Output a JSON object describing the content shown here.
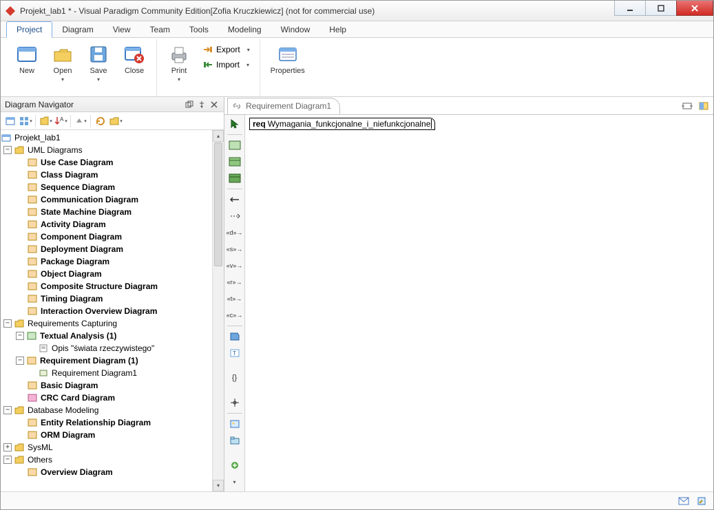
{
  "window": {
    "title": "Projekt_lab1 * - Visual Paradigm Community Edition[Zofia Kruczkiewicz] (not for commercial use)"
  },
  "menubar": {
    "items": [
      {
        "label": "Project",
        "active": true
      },
      {
        "label": "Diagram"
      },
      {
        "label": "View"
      },
      {
        "label": "Team"
      },
      {
        "label": "Tools"
      },
      {
        "label": "Modeling"
      },
      {
        "label": "Window"
      },
      {
        "label": "Help"
      }
    ]
  },
  "ribbon": {
    "new": "New",
    "open": "Open",
    "save": "Save",
    "close": "Close",
    "print": "Print",
    "export": "Export",
    "import": "Import",
    "properties": "Properties"
  },
  "navigator": {
    "title": "Diagram Navigator",
    "root": "Projekt_lab1",
    "groups": {
      "uml": {
        "label": "UML Diagrams",
        "items": [
          "Use Case Diagram",
          "Class Diagram",
          "Sequence Diagram",
          "Communication Diagram",
          "State Machine Diagram",
          "Activity Diagram",
          "Component Diagram",
          "Deployment Diagram",
          "Package Diagram",
          "Object Diagram",
          "Composite Structure Diagram",
          "Timing Diagram",
          "Interaction Overview Diagram"
        ]
      },
      "requirements": {
        "label": "Requirements Capturing",
        "textual_analysis": {
          "label": "Textual Analysis (1)",
          "child": "Opis \"świata rzeczywistego\""
        },
        "requirement_diagram": {
          "label": "Requirement Diagram (1)",
          "child": "Requirement Diagram1"
        },
        "basic_diagram": "Basic Diagram",
        "crc": "CRC Card Diagram"
      },
      "database": {
        "label": "Database Modeling",
        "items": [
          "Entity Relationship Diagram",
          "ORM Diagram"
        ]
      },
      "sysml": "SysML",
      "others": {
        "label": "Others",
        "overview": "Overview Diagram"
      }
    }
  },
  "editor": {
    "tab_label": "Requirement Diagram1",
    "req_keyword": "req",
    "req_name": "Wymagania_funkcjonalne_i_niefunkcjonalne"
  }
}
